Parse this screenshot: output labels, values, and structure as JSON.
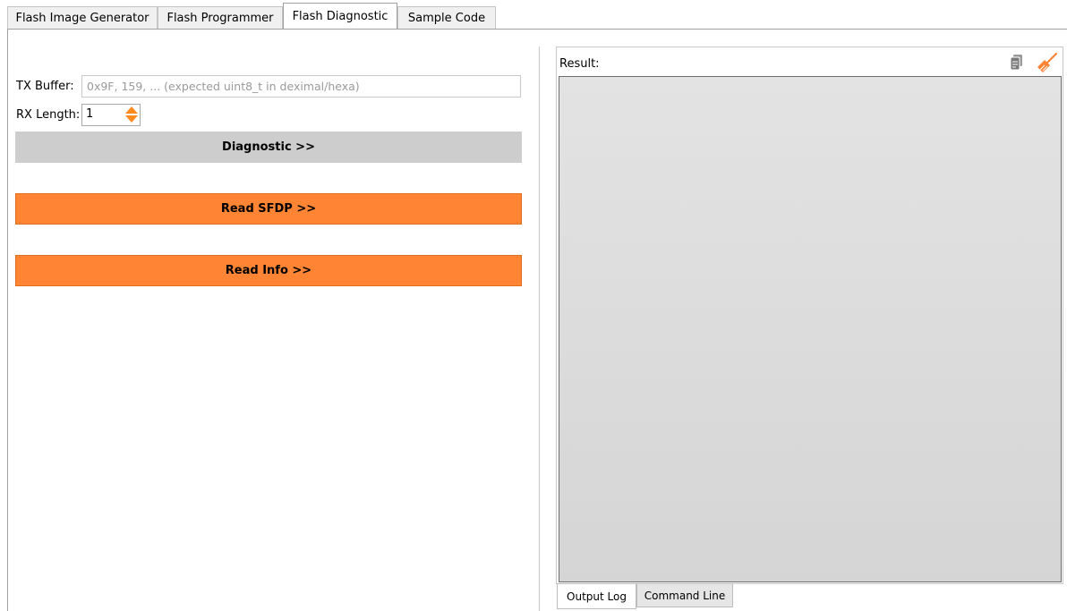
{
  "tabs": [
    {
      "label": "Flash Image Generator",
      "active": false
    },
    {
      "label": "Flash Programmer",
      "active": false
    },
    {
      "label": "Flash Diagnostic",
      "active": true
    },
    {
      "label": "Sample Code",
      "active": false
    }
  ],
  "tx": {
    "label": "TX Buffer:",
    "value": "",
    "placeholder": "0x9F, 159, ... (expected uint8_t in deximal/hexa)"
  },
  "rx": {
    "label": "RX Length:",
    "value": "1"
  },
  "buttons": {
    "diagnostic": "Diagnostic >>",
    "read_sfdp": "Read SFDP >>",
    "read_info": "Read Info >>"
  },
  "result": {
    "label": "Result:",
    "copy_icon": "copy-icon",
    "clear_icon": "broom-icon"
  },
  "bottom_tabs": [
    {
      "label": "Output Log",
      "active": true
    },
    {
      "label": "Command Line",
      "active": false
    }
  ],
  "colors": {
    "accent": "#ff8534",
    "diagnostic_button": "#cdcdcd"
  }
}
